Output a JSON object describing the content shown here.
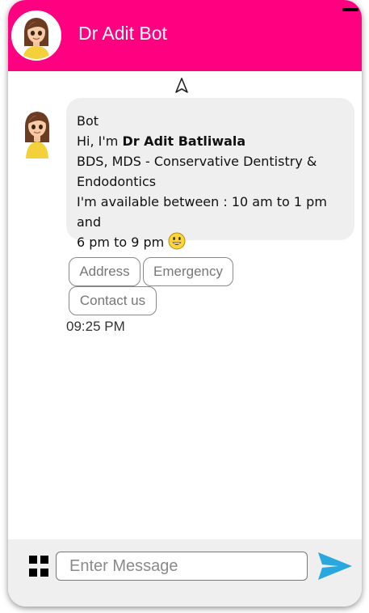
{
  "header": {
    "title": "Dr Adit Bot"
  },
  "message": {
    "sender": "Bot",
    "greeting_prefix": "Hi, I'm ",
    "doctor_name": "Dr Adit Batliwala",
    "qualifications": "BDS, MDS - Conservative Dentistry & Endodontics",
    "availability_line1": "I'm available between : 10 am to 1 pm and",
    "availability_line2": "6 pm to 9 pm",
    "timestamp": "09:25 PM"
  },
  "quick_replies": [
    "Address",
    "Emergency",
    "Contact us"
  ],
  "composer": {
    "placeholder": "Enter Message"
  },
  "colors": {
    "header_bg": "#ff0080",
    "bubble_bg": "#efefef",
    "send_icon": "#29a8e0"
  },
  "icons": {
    "scroll_top": "navigation-arrow-icon",
    "menu": "grid-menu-icon",
    "send": "paper-plane-icon",
    "emoji": "smiley-emoji-icon"
  }
}
